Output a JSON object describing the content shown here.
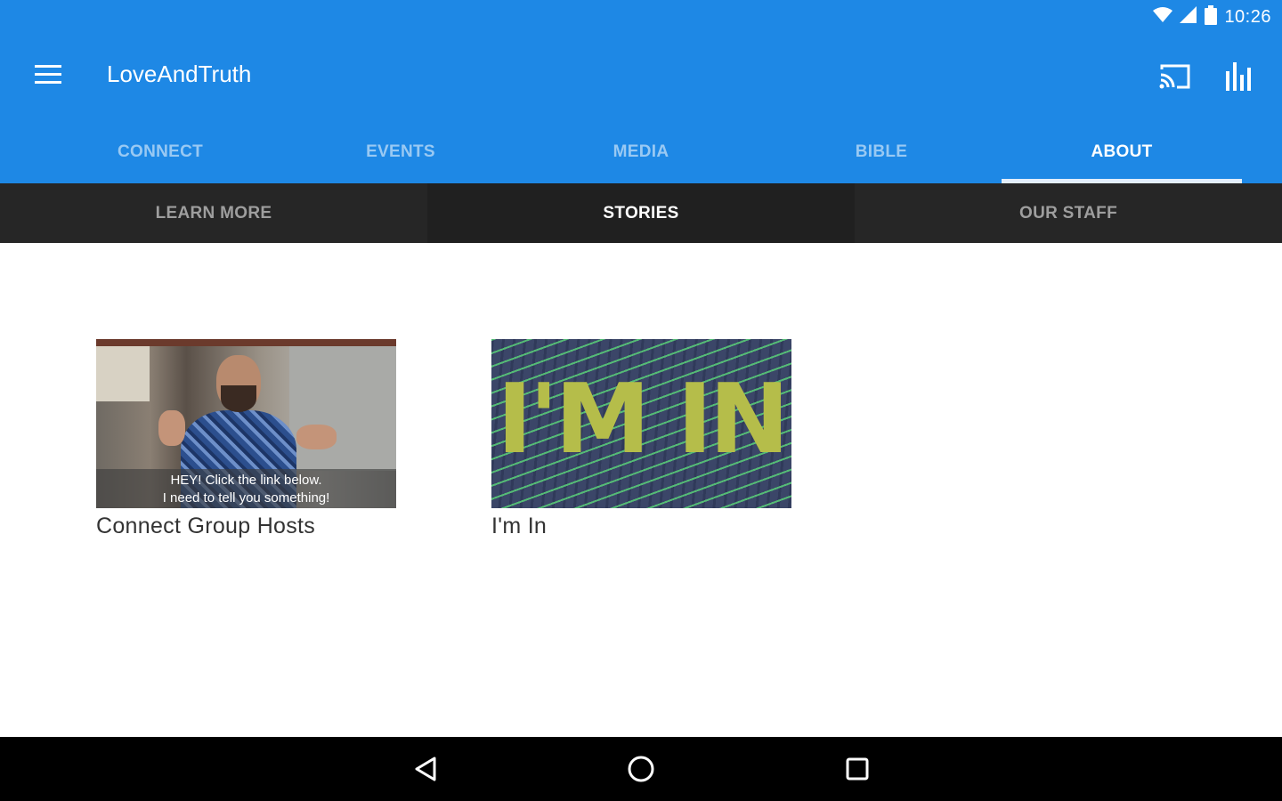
{
  "status_bar": {
    "time": "10:26",
    "icons": [
      "wifi-icon",
      "cell-signal-icon",
      "battery-icon"
    ]
  },
  "toolbar": {
    "title": "LoveAndTruth",
    "menu_icon": "hamburger-menu-icon",
    "cast_icon": "cast-icon",
    "stats_icon": "bar-chart-icon"
  },
  "tabs": [
    {
      "label": "CONNECT",
      "active": false
    },
    {
      "label": "EVENTS",
      "active": false
    },
    {
      "label": "MEDIA",
      "active": false
    },
    {
      "label": "BIBLE",
      "active": false
    },
    {
      "label": "ABOUT",
      "active": true
    }
  ],
  "subtabs": [
    {
      "label": "LEARN MORE",
      "active": false
    },
    {
      "label": "STORIES",
      "active": true
    },
    {
      "label": "OUR STAFF",
      "active": false
    }
  ],
  "stories": [
    {
      "title": "Connect Group Hosts",
      "caption_line1": "HEY! Click the link below.",
      "caption_line2": "I need to tell you something!"
    },
    {
      "title": "I'm In",
      "overlay_text": "I'M IN"
    }
  ],
  "nav_bar": {
    "icons": [
      "back-icon",
      "home-icon",
      "recents-icon"
    ]
  },
  "colors": {
    "primary": "#1e88e5",
    "subtab_bg": "#262626",
    "navbar_bg": "#000000",
    "overlay_text": "#b5bd4a"
  }
}
